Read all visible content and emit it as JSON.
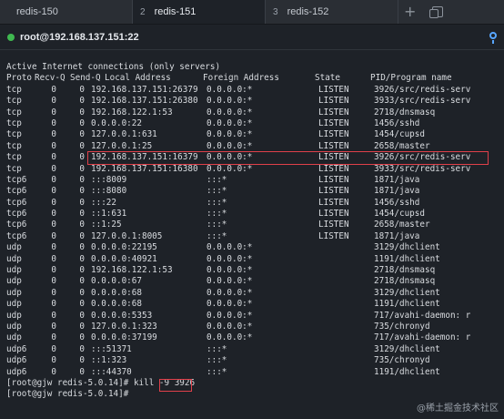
{
  "tabs": [
    {
      "label": "redis-150",
      "number": ""
    },
    {
      "label": "redis-151",
      "number": "2"
    },
    {
      "label": "redis-152",
      "number": "3"
    }
  ],
  "session": {
    "title": "root@192.168.137.151:22"
  },
  "terminal": {
    "header_line": "Active Internet connections (only servers)",
    "columns": [
      "Proto",
      "Recv-Q",
      "Send-Q",
      "Local Address",
      "Foreign Address",
      "State",
      "PID/Program name"
    ],
    "rows": [
      [
        "tcp",
        "0",
        "0",
        "192.168.137.151:26379",
        "0.0.0.0:*",
        "LISTEN",
        "3926/src/redis-serv"
      ],
      [
        "tcp",
        "0",
        "0",
        "192.168.137.151:26380",
        "0.0.0.0:*",
        "LISTEN",
        "3933/src/redis-serv"
      ],
      [
        "tcp",
        "0",
        "0",
        "192.168.122.1:53",
        "0.0.0.0:*",
        "LISTEN",
        "2718/dnsmasq"
      ],
      [
        "tcp",
        "0",
        "0",
        "0.0.0.0:22",
        "0.0.0.0:*",
        "LISTEN",
        "1456/sshd"
      ],
      [
        "tcp",
        "0",
        "0",
        "127.0.0.1:631",
        "0.0.0.0:*",
        "LISTEN",
        "1454/cupsd"
      ],
      [
        "tcp",
        "0",
        "0",
        "127.0.0.1:25",
        "0.0.0.0:*",
        "LISTEN",
        "2658/master"
      ],
      [
        "tcp",
        "0",
        "0",
        "192.168.137.151:16379",
        "0.0.0.0:*",
        "LISTEN",
        "3926/src/redis-serv"
      ],
      [
        "tcp",
        "0",
        "0",
        "192.168.137.151:16380",
        "0.0.0.0:*",
        "LISTEN",
        "3933/src/redis-serv"
      ],
      [
        "tcp6",
        "0",
        "0",
        ":::8009",
        ":::*",
        "LISTEN",
        "1871/java"
      ],
      [
        "tcp6",
        "0",
        "0",
        ":::8080",
        ":::*",
        "LISTEN",
        "1871/java"
      ],
      [
        "tcp6",
        "0",
        "0",
        ":::22",
        ":::*",
        "LISTEN",
        "1456/sshd"
      ],
      [
        "tcp6",
        "0",
        "0",
        "::1:631",
        ":::*",
        "LISTEN",
        "1454/cupsd"
      ],
      [
        "tcp6",
        "0",
        "0",
        "::1:25",
        ":::*",
        "LISTEN",
        "2658/master"
      ],
      [
        "tcp6",
        "0",
        "0",
        "127.0.0.1:8005",
        ":::*",
        "LISTEN",
        "1871/java"
      ],
      [
        "udp",
        "0",
        "0",
        "0.0.0.0:22195",
        "0.0.0.0:*",
        "",
        "3129/dhclient"
      ],
      [
        "udp",
        "0",
        "0",
        "0.0.0.0:40921",
        "0.0.0.0:*",
        "",
        "1191/dhclient"
      ],
      [
        "udp",
        "0",
        "0",
        "192.168.122.1:53",
        "0.0.0.0:*",
        "",
        "2718/dnsmasq"
      ],
      [
        "udp",
        "0",
        "0",
        "0.0.0.0:67",
        "0.0.0.0:*",
        "",
        "2718/dnsmasq"
      ],
      [
        "udp",
        "0",
        "0",
        "0.0.0.0:68",
        "0.0.0.0:*",
        "",
        "3129/dhclient"
      ],
      [
        "udp",
        "0",
        "0",
        "0.0.0.0:68",
        "0.0.0.0:*",
        "",
        "1191/dhclient"
      ],
      [
        "udp",
        "0",
        "0",
        "0.0.0.0:5353",
        "0.0.0.0:*",
        "",
        "717/avahi-daemon: r"
      ],
      [
        "udp",
        "0",
        "0",
        "127.0.0.1:323",
        "0.0.0.0:*",
        "",
        "735/chronyd"
      ],
      [
        "udp",
        "0",
        "0",
        "0.0.0.0:37199",
        "0.0.0.0:*",
        "",
        "717/avahi-daemon: r"
      ],
      [
        "udp6",
        "0",
        "0",
        ":::51371",
        ":::*",
        "",
        "3129/dhclient"
      ],
      [
        "udp6",
        "0",
        "0",
        "::1:323",
        ":::*",
        "",
        "735/chronyd"
      ],
      [
        "udp6",
        "0",
        "0",
        ":::44370",
        ":::*",
        "",
        "1191/dhclient"
      ]
    ],
    "prompt1": "[root@gjw redis-5.0.14]# ",
    "command1": "kill -9 3926",
    "prompt2": "[root@gjw redis-5.0.14]# "
  },
  "watermark": "@稀土掘金技术社区",
  "colors": {
    "tabbar": "#2a2e34",
    "background": "#1e2228",
    "highlight": "#e0404a",
    "status": "#3fb950"
  }
}
